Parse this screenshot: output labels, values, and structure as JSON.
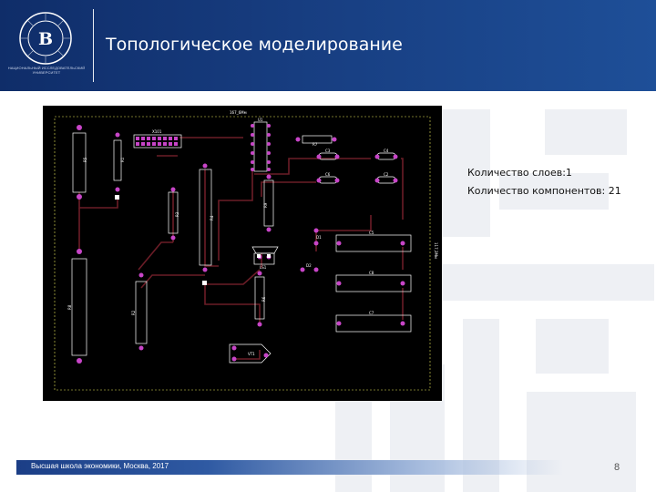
{
  "header": {
    "title": "Топологическое моделирование",
    "logo_caption": "НАЦИОНАЛЬНЫЙ ИССЛЕДОВАТЕЛЬСКИЙ УНИВЕРСИТЕТ",
    "logo_ring_text": "ВЫСШАЯ ШКОЛА ЭКОНОМИКИ",
    "background": "#173d80"
  },
  "info": {
    "layers": "Количество слоев:1",
    "components": "Количество компонентов: 21"
  },
  "pcb": {
    "board_label": "167_6Мм",
    "side_label": "117,3Мм",
    "components": {
      "r_left_top": "R5",
      "r_small": "R1",
      "connector": "X101",
      "u1": "U1",
      "r7": "R7",
      "c3": "C3",
      "c4": "C4",
      "c6": "C6",
      "c2": "C2",
      "r3": "R3",
      "r4": "R4",
      "r9": "R9",
      "c5": "C5",
      "c8": "C8",
      "c7": "C7",
      "ls1": "LS1",
      "r8": "R8",
      "r2": "R2",
      "r6": "R6",
      "vt1": "VT1",
      "d1": "D1",
      "d2": "D2"
    },
    "colors": {
      "board": "#000000",
      "trace": "#6b1d27",
      "pad": "#c845c8",
      "silk": "#ffffff",
      "pad_square": "#ffffff"
    }
  },
  "footer": {
    "text": "Высшая школа экономики, Москва, 2017",
    "page_number": "8"
  }
}
